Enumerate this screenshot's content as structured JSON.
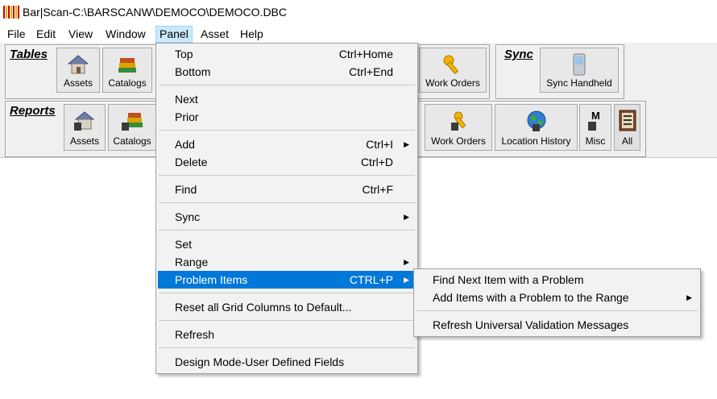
{
  "window": {
    "title": "Bar|Scan-C:\\BARSCANW\\DEMOCO\\DEMOCO.DBC"
  },
  "menubar": [
    "File",
    "Edit",
    "View",
    "Window",
    "Panel",
    "Asset",
    "Help"
  ],
  "tables_group": {
    "label": "Tables",
    "buttons": [
      "Assets",
      "Catalogs",
      "Work Orders"
    ]
  },
  "sync_group": {
    "label": "Sync",
    "button": "Sync Handheld"
  },
  "reports_group": {
    "label": "Reports",
    "buttons": [
      "Assets",
      "Catalogs",
      "Work Orders",
      "Location History",
      "Misc",
      "All"
    ]
  },
  "panel_menu": {
    "items": [
      {
        "label": "Top",
        "shortcut": "Ctrl+Home"
      },
      {
        "label": "Bottom",
        "shortcut": "Ctrl+End"
      },
      {
        "label": "Next",
        "shortcut": ""
      },
      {
        "label": "Prior",
        "shortcut": ""
      },
      {
        "label": "Add",
        "shortcut": "Ctrl+I"
      },
      {
        "label": "Delete",
        "shortcut": "Ctrl+D"
      },
      {
        "label": "Find",
        "shortcut": "Ctrl+F"
      },
      {
        "label": "Sync",
        "shortcut": ""
      },
      {
        "label": "Set",
        "shortcut": ""
      },
      {
        "label": "Range",
        "shortcut": ""
      },
      {
        "label": "Problem Items",
        "shortcut": "CTRL+P"
      },
      {
        "label": "Reset all Grid Columns to Default...",
        "shortcut": ""
      },
      {
        "label": "Refresh",
        "shortcut": ""
      },
      {
        "label": "Design Mode-User Defined Fields",
        "shortcut": ""
      }
    ]
  },
  "problem_submenu": {
    "items": [
      "Find Next Item with a Problem",
      "Add Items with a Problem to the Range",
      "Refresh Universal Validation Messages"
    ]
  },
  "colors": {
    "highlight": "#0078d7",
    "menu_bg": "#f2f2f2",
    "toolbar_bg": "#f0f0f0"
  }
}
